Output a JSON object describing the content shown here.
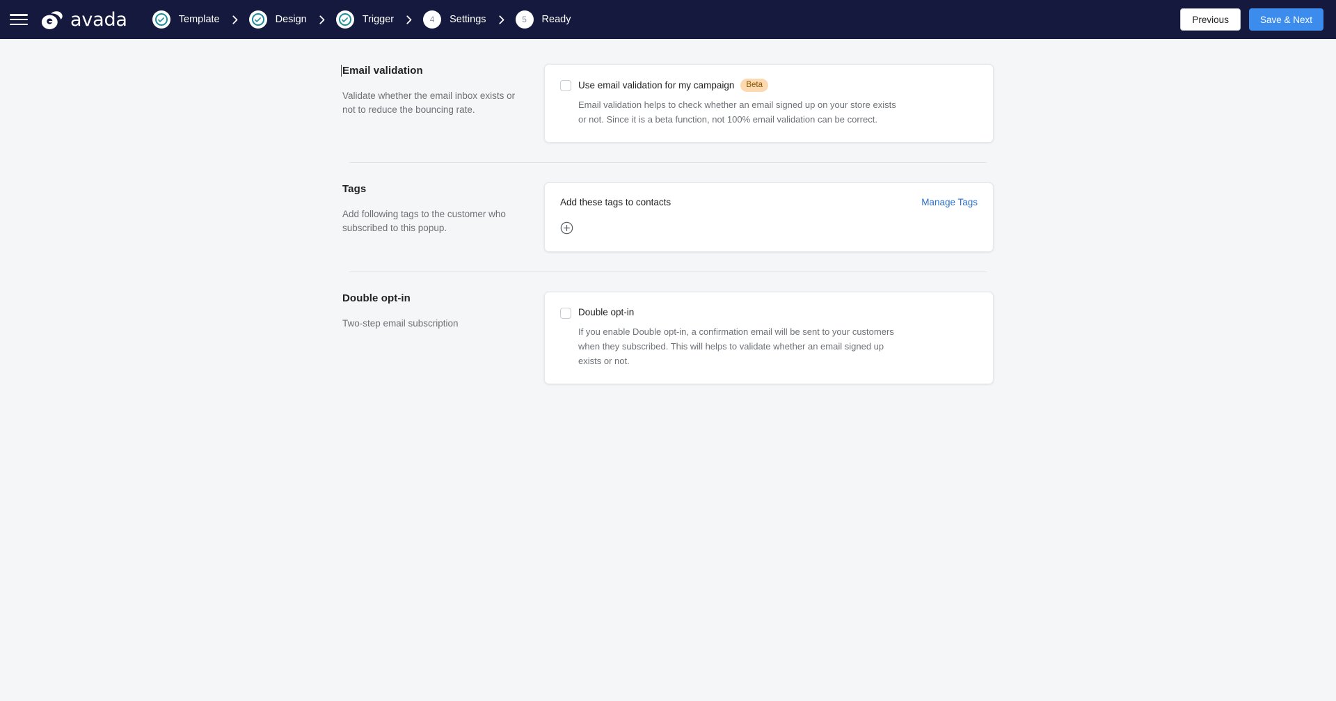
{
  "header": {
    "menu_icon": "hamburger-icon",
    "brand": "avada",
    "brand_logo_icon": "avada-logo-icon",
    "steps": [
      {
        "num": "1",
        "label": "Template",
        "state": "done"
      },
      {
        "num": "2",
        "label": "Design",
        "state": "done"
      },
      {
        "num": "3",
        "label": "Trigger",
        "state": "done"
      },
      {
        "num": "4",
        "label": "Settings",
        "state": "current"
      },
      {
        "num": "5",
        "label": "Ready",
        "state": "upcoming"
      }
    ],
    "previous_label": "Previous",
    "save_next_label": "Save & Next"
  },
  "colors": {
    "topbar_bg": "#14193d",
    "page_bg": "#f4f6f8",
    "primary_button": "#3b8ced",
    "step_done_accent": "#1c8c9c",
    "link": "#2c6ecb",
    "badge_bg": "#fcd9b0",
    "badge_text": "#8a5300"
  },
  "sections": {
    "email_validation": {
      "title": "Email validation",
      "description": "Validate whether the email inbox exists or not to reduce the bouncing rate.",
      "checkbox_label": "Use email validation for my campaign",
      "badge": "Beta",
      "checked": false,
      "help": "Email validation helps to check whether an email signed up on your store exists or not. Since it is a beta function, not 100% email validation can be correct."
    },
    "tags": {
      "title": "Tags",
      "description": "Add following tags to the customer who subscribed to this popup.",
      "card_label": "Add these tags to contacts",
      "manage_link": "Manage Tags",
      "add_icon": "plus-circle-icon"
    },
    "double_opt_in": {
      "title": "Double opt-in",
      "description": "Two-step email subscription",
      "checkbox_label": "Double opt-in",
      "checked": false,
      "help": "If you enable Double opt-in, a confirmation email will be sent to your customers when they subscribed. This will helps to validate whether an email signed up exists or not."
    }
  }
}
